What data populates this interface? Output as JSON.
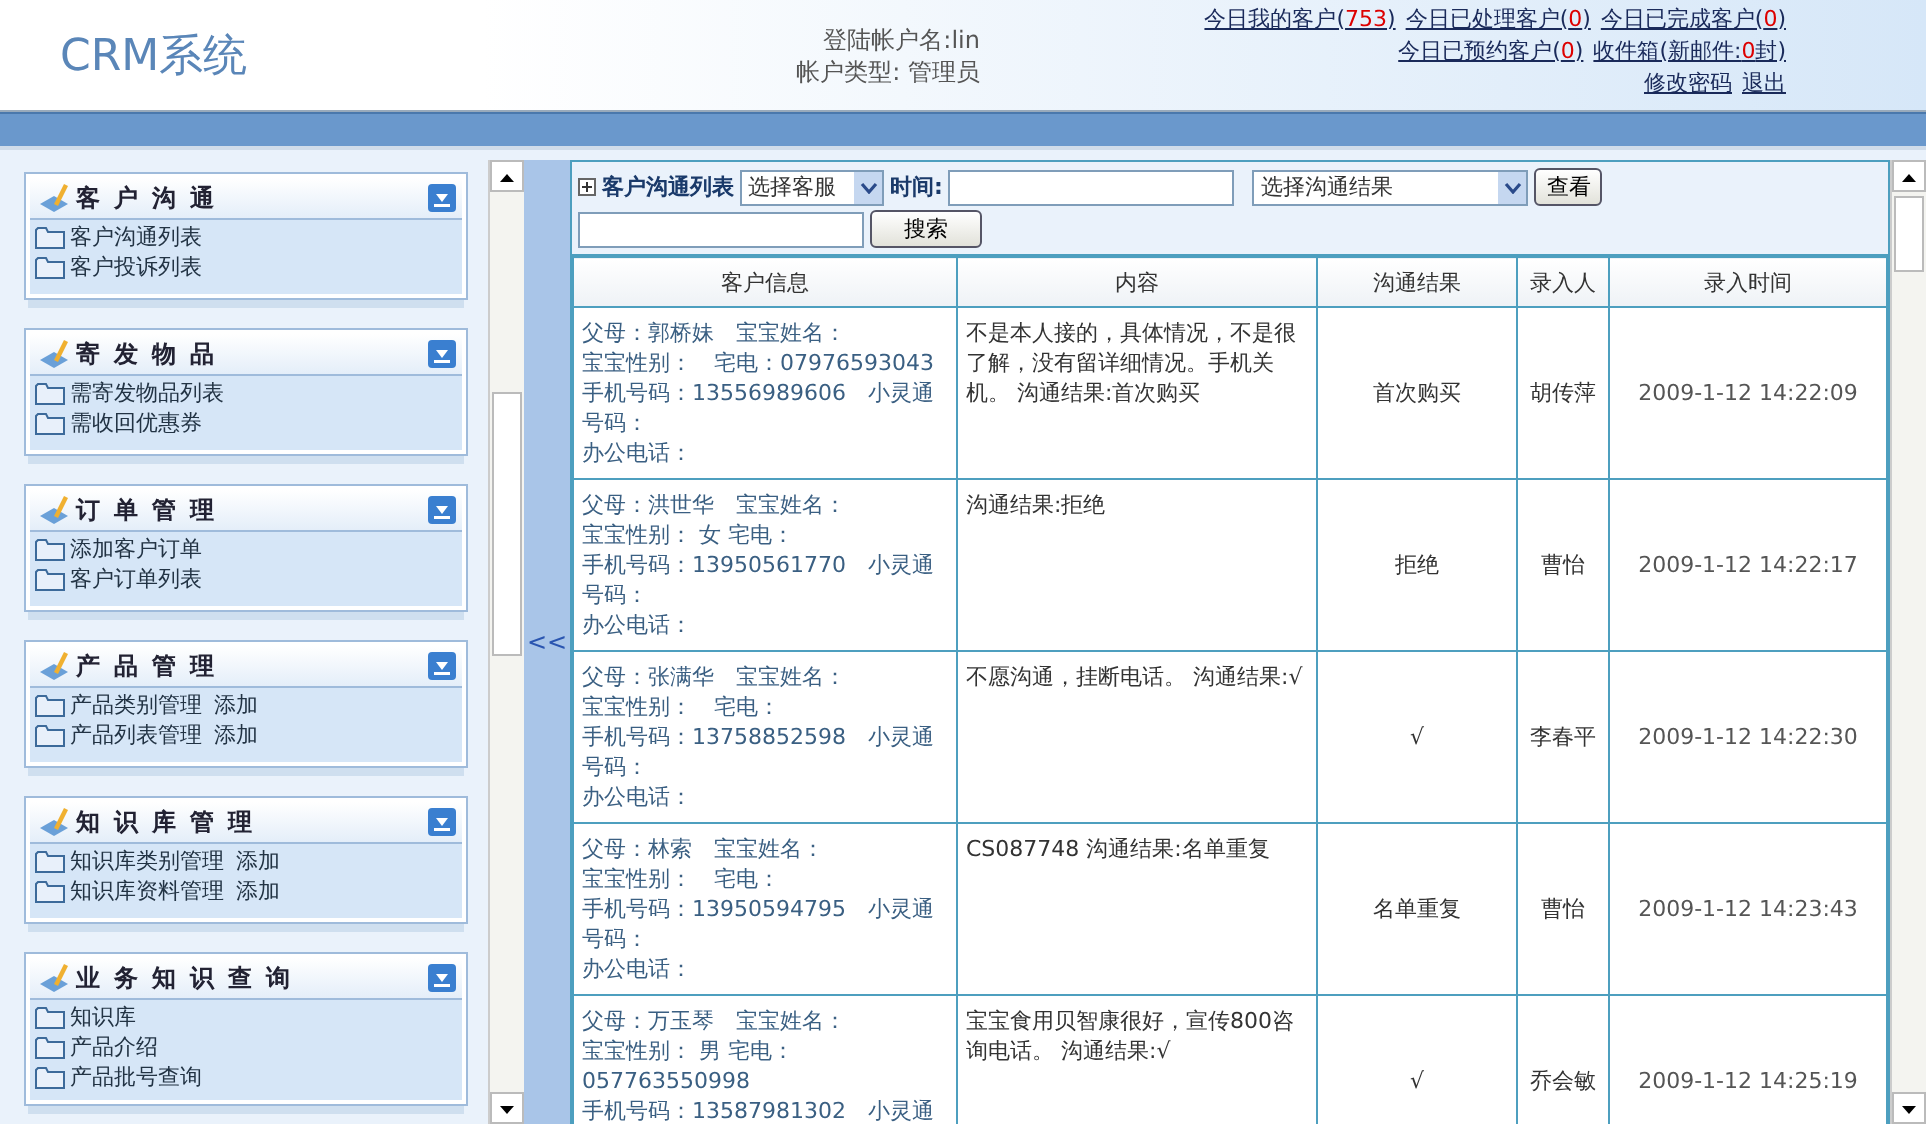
{
  "header": {
    "logo": "CRM系统",
    "account_lines": [
      "登陆帐户名:lin",
      "帐户类型: 管理员"
    ],
    "link_rows": [
      [
        {
          "prefix": "今日我的客户(",
          "count": "753",
          "suffix": ")"
        },
        {
          "prefix": "今日已处理客户(",
          "count": "0",
          "suffix": ")"
        },
        {
          "prefix": "今日已完成客户(",
          "count": "0",
          "suffix": ")"
        }
      ],
      [
        {
          "prefix": "今日已预约客户(",
          "count": "0",
          "suffix": ")"
        },
        {
          "prefix": "收件箱(新邮件:",
          "count": "0",
          "suffix": "封)"
        }
      ],
      [
        {
          "prefix": "修改密码"
        },
        {
          "prefix": "退出"
        }
      ]
    ]
  },
  "sidebar": {
    "sections": [
      {
        "title": "客户沟通",
        "items": [
          {
            "label": "客户沟通列表"
          },
          {
            "label": "客户投诉列表"
          }
        ]
      },
      {
        "title": "寄发物品",
        "items": [
          {
            "label": "需寄发物品列表"
          },
          {
            "label": "需收回优惠券"
          }
        ]
      },
      {
        "title": "订单管理",
        "items": [
          {
            "label": "添加客户订单"
          },
          {
            "label": "客户订单列表"
          }
        ]
      },
      {
        "title": "产品管理",
        "items": [
          {
            "label": "产品类别管理",
            "action": "添加"
          },
          {
            "label": "产品列表管理",
            "action": "添加"
          }
        ]
      },
      {
        "title": "知识库管理",
        "items": [
          {
            "label": "知识库类别管理",
            "action": "添加"
          },
          {
            "label": "知识库资料管理",
            "action": "添加"
          }
        ]
      },
      {
        "title": "业务知识查询",
        "items": [
          {
            "label": "知识库"
          },
          {
            "label": "产品介绍"
          },
          {
            "label": "产品批号查询"
          }
        ]
      }
    ]
  },
  "collapse_toggle": "<<",
  "filter": {
    "title": "客户沟通列表",
    "staff_select": "选择客服",
    "time_label": "时间:",
    "result_select": "选择沟通结果",
    "view_button": "查看",
    "search_button": "搜索"
  },
  "table": {
    "columns": [
      "客户信息",
      "内容",
      "沟通结果",
      "录入人",
      "录入时间"
    ],
    "rows": [
      {
        "info": [
          "父母：郭桥妹　宝宝姓名：",
          "宝宝性别：　宅电：07976593043",
          "手机号码：13556989606　小灵通",
          "号码：",
          "办公电话："
        ],
        "content": "不是本人接的，具体情况，不是很了解，没有留详细情况。手机关机。 沟通结果:首次购买",
        "result": "首次购买",
        "recorder": "胡传萍",
        "time": "2009-1-12 14:22:09"
      },
      {
        "info": [
          "父母：洪世华　宝宝姓名：",
          "宝宝性别：  女  宅电：",
          "手机号码：13950561770　小灵通",
          "号码：",
          "办公电话："
        ],
        "content": "沟通结果:拒绝",
        "result": "拒绝",
        "recorder": "曹怡",
        "time": "2009-1-12 14:22:17"
      },
      {
        "info": [
          "父母：张满华　宝宝姓名：",
          "宝宝性别：　宅电：",
          "手机号码：13758852598　小灵通",
          "号码：",
          "办公电话："
        ],
        "content": "不愿沟通，挂断电话。 沟通结果:√",
        "result": "√",
        "recorder": "李春平",
        "time": "2009-1-12 14:22:30"
      },
      {
        "info": [
          "父母：林索　宝宝姓名：",
          "宝宝性别：　宅电：",
          "手机号码：13950594795　小灵通",
          "号码：",
          "办公电话："
        ],
        "content": "CS087748 沟通结果:名单重复",
        "result": "名单重复",
        "recorder": "曹怡",
        "time": "2009-1-12 14:23:43"
      },
      {
        "info": [
          "父母：万玉琴　宝宝姓名：",
          "宝宝性别：  男  宅电：",
          "057763550998",
          "手机号码：13587981302　小灵通"
        ],
        "content": "宝宝食用贝智康很好，宣传800咨询电话。 沟通结果:√",
        "result": "√",
        "recorder": "乔会敏",
        "time": "2009-1-12 14:25:19"
      }
    ]
  }
}
